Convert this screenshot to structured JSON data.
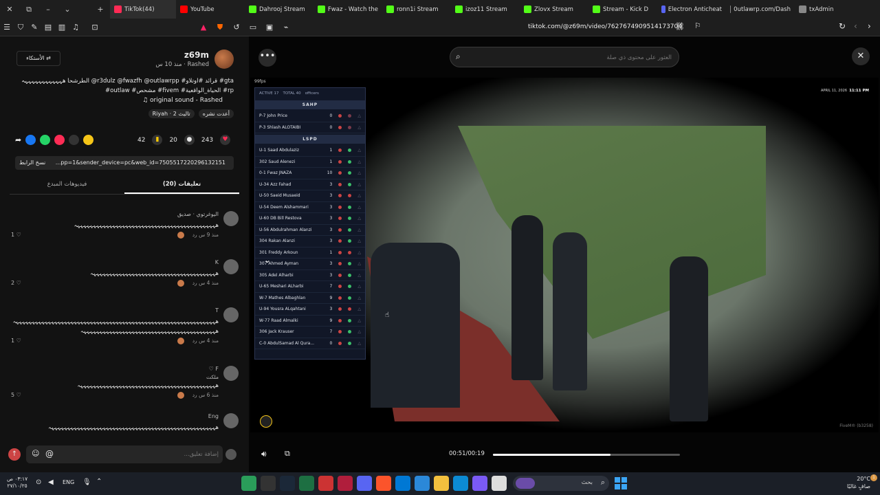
{
  "tabs": [
    {
      "label": "TikTok(44)",
      "active": true,
      "color": "#ff2b55"
    },
    {
      "label": "YouTube",
      "color": "#ff0000"
    },
    {
      "label": "Dahrooj Stream",
      "color": "#53fc18"
    },
    {
      "label": "Fwaz - Watch the",
      "color": "#53fc18"
    },
    {
      "label": "ronn1i Stream",
      "color": "#53fc18"
    },
    {
      "label": "izoz11 Stream",
      "color": "#53fc18"
    },
    {
      "label": "Zlovx Stream",
      "color": "#53fc18"
    },
    {
      "label": "Stream - Kick D",
      "color": "#53fc18"
    },
    {
      "label": "Electron Anticheat",
      "color": "#5865f2"
    },
    {
      "label": "0utlawrp.com/Dash",
      "color": "#888"
    },
    {
      "label": "txAdmin",
      "color": "#888"
    }
  ],
  "url": "tiktok.com/@z69m/video/7627674909514173704",
  "post": {
    "username": "z69m",
    "author_line": "Rashed · منذ 10 س",
    "follow_label": "الأستكاء ⇄",
    "caption_1": "الطرشحا هہہہہہہہہہہہہ @r3dulz @fwazfh @outlawrpp #قرائد #اوتلاو #gta",
    "caption_2": "#outlaw #مشحص #fivem #الحياة_الواقعية #rp",
    "sound": "♫ original sound - Rashed",
    "repost": "أعدت نشره",
    "tagged": "Riyah · تاليث 2",
    "likes": "243",
    "comments_count": "20",
    "saves": "42",
    "link_text": "...pp=1&sender_device=pc&web_id=7505517220296132151",
    "copy_link": "نسخ الرابط",
    "tab_comments": "تعليقات (20)",
    "tab_creator": "فيديوهات المبدع"
  },
  "comments": [
    {
      "name": "اليوغرتوي · صديق",
      "text": "هہہہہہہہہہہہہہہہہہہہہہہہہہہہہہہہہہہہہہہہہہہہہ",
      "meta": "منذ 9 س   رد",
      "likes": "1"
    },
    {
      "name": "K",
      "text": "هہہہہہہہہہہہہہہہہہہہہہہہہہہہہہہہہہہہہہہہ",
      "meta": "منذ 4 س   رد",
      "likes": "2"
    },
    {
      "name": "T",
      "text": "هہہہہہہہہہہہہہہہہہہہہہہہہہہہہہہہہہہہہہہہہہہہہہہہہہہہہہہہہہہہہہہہ",
      "text2": "هہہہہہہہہہہہہہہہہہہہہہہہہہہہہہہہہہہہہہہہہہہ",
      "meta": "منذ 4 س   رد",
      "likes": "1"
    },
    {
      "name": "F ♡",
      "sub": "ملكت",
      "text": "هہہہہہہہہہہہہہہہہہہہہہہہہہہہہہہہہہہہہہہہہہہہ",
      "meta": "منذ 6 س   رد",
      "likes": "5"
    },
    {
      "name": "Eng",
      "text": "هہہہہہہہہہہہہہہہہہہہہہہہہہہہہہہہہہہہہہہہہہہہہہہہہہہہہ",
      "meta": "",
      "likes": ""
    }
  ],
  "comment_placeholder": "إضافة تعليق...",
  "search_placeholder": "العثور على محتوى ذي صلة",
  "video": {
    "fps": "99fps",
    "date": "APRIL 11, 2026",
    "time": "11:11 PM",
    "active": "ACTIVE 17",
    "total": "TOTAL 40",
    "total_label": "officers",
    "time_display": "00:51/00:19",
    "progress": 0.63,
    "watermark": "FiveM® (b3258)"
  },
  "scoreboard": {
    "groups": [
      {
        "title": "SAHP",
        "rows": [
          [
            "P-7 John Price",
            "0"
          ],
          [
            "P-3 Shlash ALOTAIBI",
            "0"
          ]
        ]
      },
      {
        "title": "LSPD",
        "rows": [
          [
            "U-1 Saad Abdulaziz",
            "1"
          ],
          [
            "302 Saud Alenezi",
            "1"
          ],
          [
            "0-1 Fwaz JNAZA",
            "10"
          ],
          [
            "U-34 Azz Fahad",
            "3"
          ],
          [
            "U-50 Saeid Musaeid",
            "3"
          ],
          [
            "U-54 Deem Alshammari",
            "3"
          ],
          [
            "U-60 DB Bill Restova",
            "3"
          ],
          [
            "U-56 Abdulrahman Alanzi",
            "3"
          ],
          [
            "304 Rakan Alanzi",
            "3"
          ],
          [
            "301 Freddy Arkoun",
            "1"
          ],
          [
            "307 Ahmed Ayman",
            "3"
          ],
          [
            "305 Adel Alharbi",
            "3"
          ],
          [
            "U-65 Meshari ALharbi",
            "7"
          ],
          [
            "W-7 Mathes Albaghlan",
            "9"
          ],
          [
            "U-94 Yousra ALqahtani",
            "3"
          ],
          [
            "W-77 Raad Almalki",
            "9"
          ],
          [
            "306 Jack Krauser",
            "7"
          ],
          [
            "C-0 AbdulSamad Al Qura...",
            "0"
          ]
        ]
      }
    ]
  },
  "taskbar": {
    "search": "بحث",
    "lang": "ENG",
    "time": "٠٣:١٧ ص",
    "date": "٢٧/١٠/٢٥",
    "weather": "20°C",
    "weather_desc": "صافٍ غالبًا"
  }
}
